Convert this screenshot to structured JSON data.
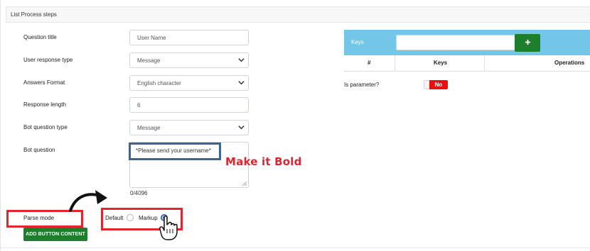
{
  "panel": {
    "title": "List Process steps"
  },
  "form": {
    "question_title": {
      "label": "Question title",
      "value": "User Name"
    },
    "user_response_type": {
      "label": "User response type",
      "value": "Message"
    },
    "answers_format": {
      "label": "Answers Format",
      "value": "English character"
    },
    "response_length": {
      "label": "Response length",
      "value": "6"
    },
    "bot_question_type": {
      "label": "Bot question type",
      "value": "Message"
    },
    "bot_question": {
      "label": "Bot question",
      "value": "*Please send your username*",
      "counter": "0/4096"
    },
    "parse_mode": {
      "label": "Parse mode",
      "options": [
        {
          "label": "Default",
          "selected": false
        },
        {
          "label": "Markup",
          "selected": true
        }
      ]
    },
    "add_button_label": "ADD BUTTON CONTENT"
  },
  "annotations": {
    "note": "Make it Bold",
    "highlight_color_red": "#e6242c",
    "highlight_color_blue": "#3d6591"
  },
  "keys": {
    "title": "Keys",
    "input_value": "",
    "add_icon": "plus-icon",
    "columns": [
      "#",
      "Keys",
      "Operations"
    ]
  },
  "parameter": {
    "label": "Is parameter?",
    "toggle_label": "No",
    "toggle_on": false
  },
  "colors": {
    "accent_green": "#1d7f2b",
    "keys_bar": "#74c6e9",
    "toggle_red": "#e81010"
  }
}
